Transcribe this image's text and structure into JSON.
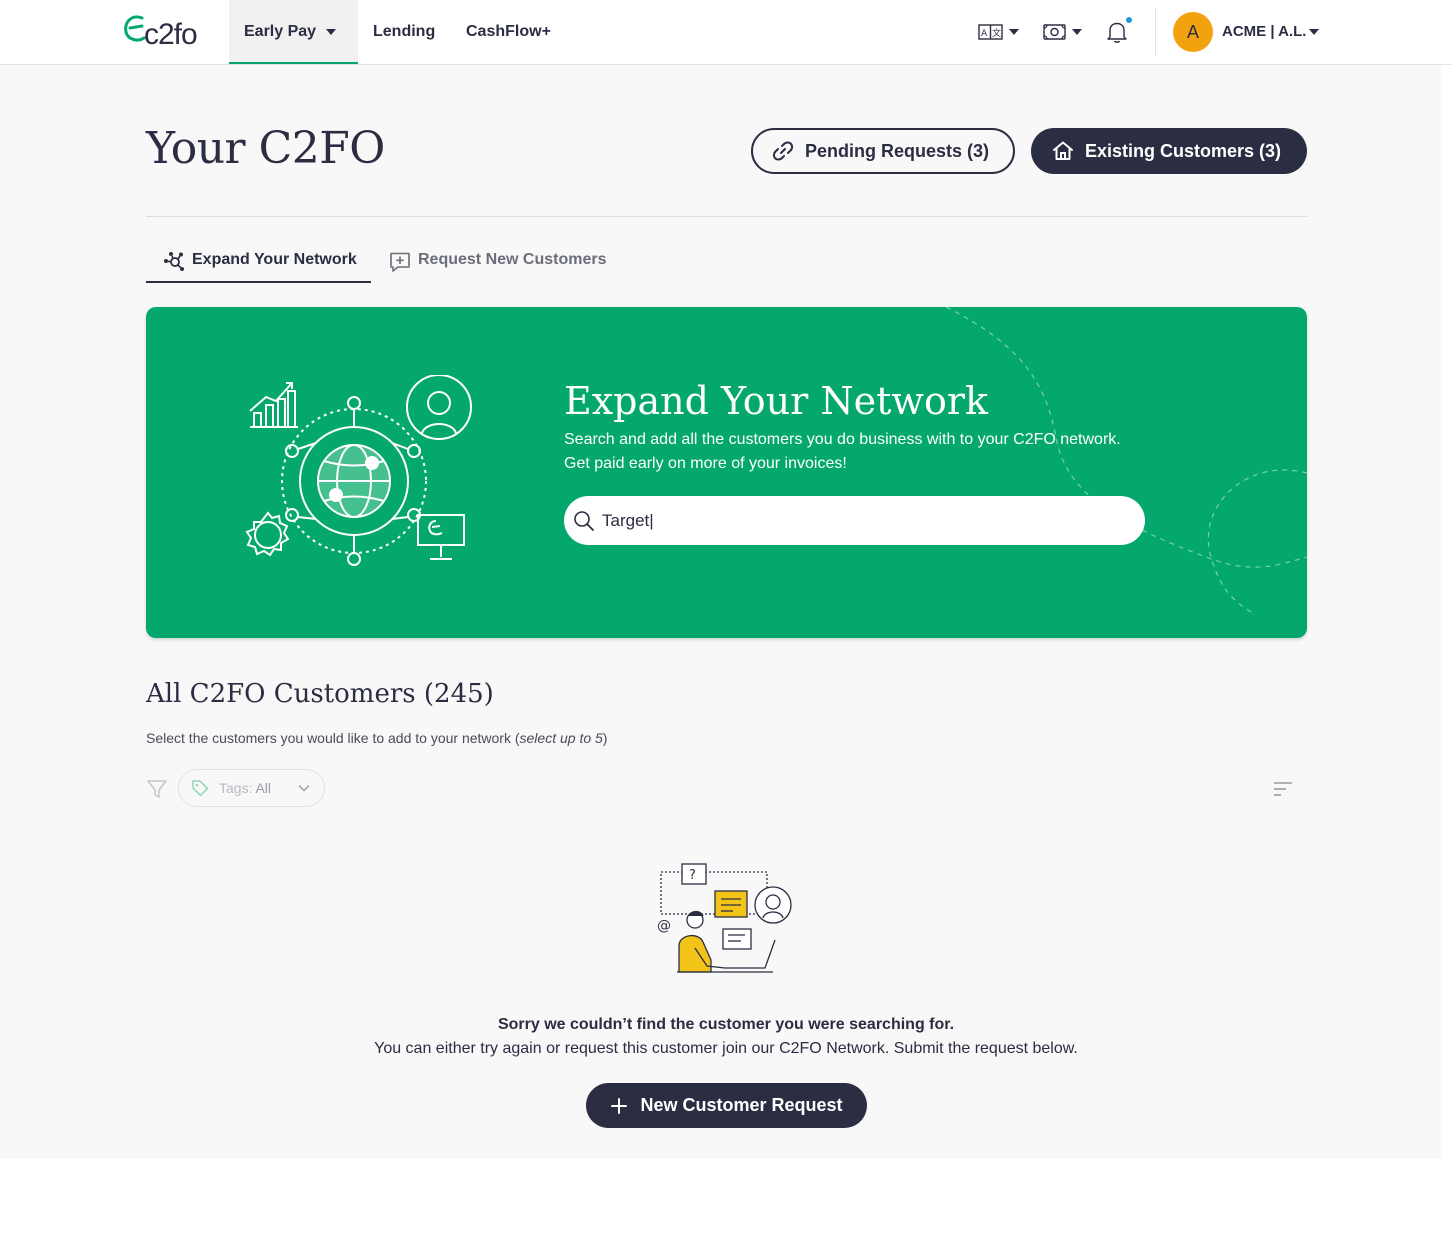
{
  "brand": {
    "logo_text": "c2fo",
    "green": "#05a86c",
    "navy": "#2b2d42",
    "accent_orange": "#f2a20f"
  },
  "nav": {
    "items": [
      {
        "label": "Early Pay",
        "active": true,
        "has_dropdown": true
      },
      {
        "label": "Lending"
      },
      {
        "label": "CashFlow+"
      }
    ],
    "tools": [
      "language-icon",
      "currency-icon",
      "bell-icon"
    ],
    "notification_dot": true,
    "avatar_initial": "A",
    "account_label": "ACME |  A.L."
  },
  "page": {
    "title": "Your C2FO",
    "pending_button": "Pending Requests (3)",
    "existing_button": "Existing Customers (3)"
  },
  "tabs": [
    {
      "label": "Expand Your Network",
      "active": true,
      "icon": "network-icon"
    },
    {
      "label": "Request New Customers",
      "active": false,
      "icon": "chat-plus-icon"
    }
  ],
  "hero": {
    "title": "Expand Your Network",
    "subtitle_line1": "Search and add all the customers you do business with to your C2FO network.",
    "subtitle_line2": "Get paid early on more of your invoices!",
    "search_value": "Target|"
  },
  "customers": {
    "title": "All C2FO Customers (245)",
    "subtitle": "Select the customers you would like to add to your network (",
    "subtitle_em": "select up to 5",
    "subtitle_end": ")",
    "tags_label": "Tags:",
    "tags_value": "All"
  },
  "empty": {
    "bold": "Sorry we couldn’t find the customer you were searching for.",
    "text": "You can either try again or request this customer join our C2FO Network. Submit the request below.",
    "button": "New Customer Request"
  }
}
